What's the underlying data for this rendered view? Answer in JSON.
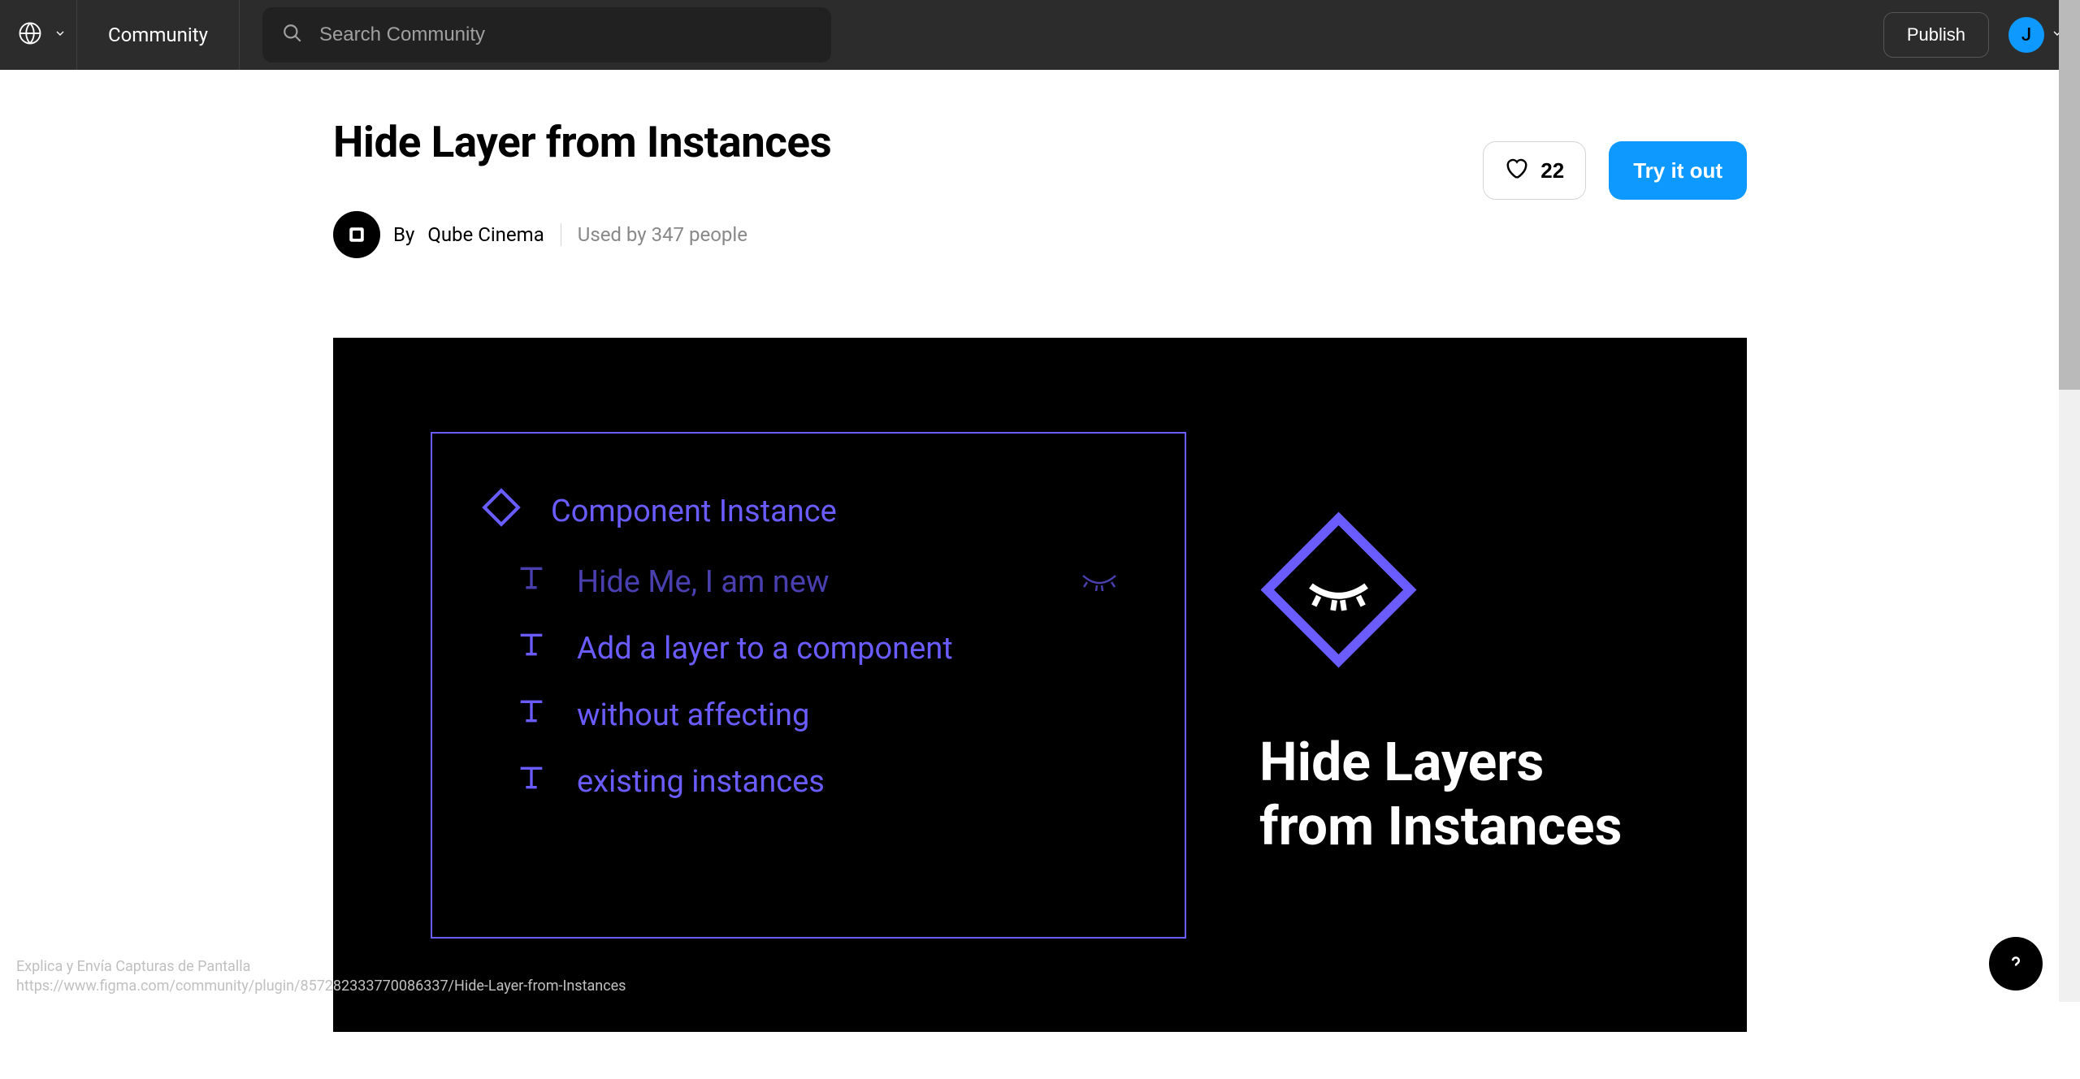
{
  "header": {
    "community_label": "Community",
    "search_placeholder": "Search Community",
    "publish_label": "Publish",
    "avatar_initial": "J"
  },
  "page": {
    "title": "Hide Layer from Instances",
    "like_count": "22",
    "try_button": "Try it out",
    "author": {
      "by": "By",
      "name": "Qube Cinema"
    },
    "usage": "Used by 347 people"
  },
  "hero": {
    "layers": {
      "root": "Component Instance",
      "item1": "Hide Me, I am new",
      "item2": "Add a layer to a component",
      "item3": "without affecting",
      "item4": "existing instances"
    },
    "title_line1": "Hide Layers",
    "title_line2": "from Instances"
  },
  "footer": {
    "line1": "Explica y Envía Capturas de Pantalla",
    "line2": "https://www.figma.com/community/plugin/857282333770086337/Hide-Layer-from-Instances"
  }
}
